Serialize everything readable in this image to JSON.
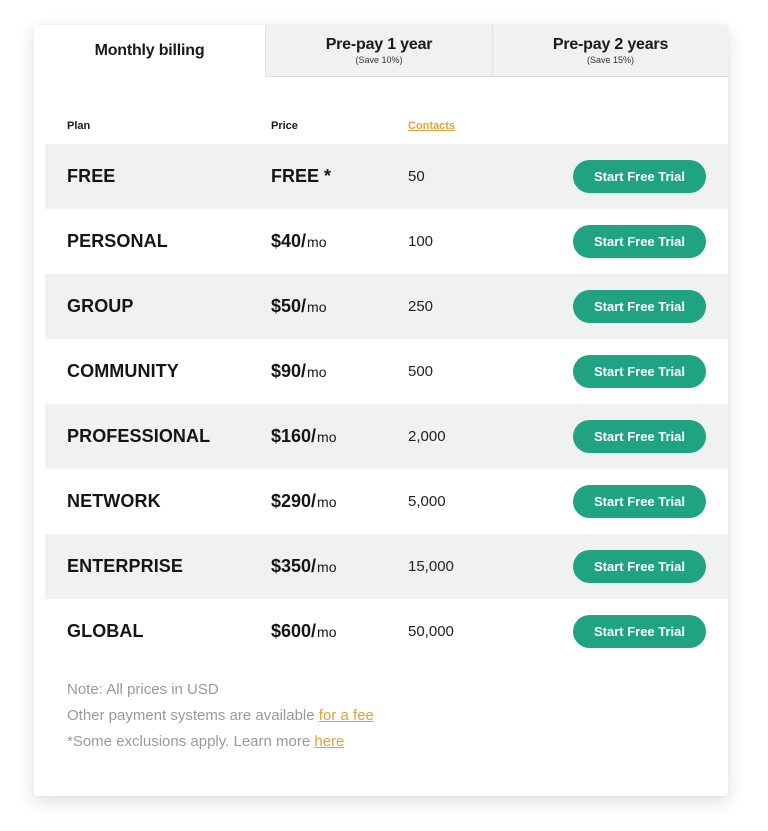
{
  "tabs": [
    {
      "title": "Monthly billing",
      "subtitle": "",
      "active": true
    },
    {
      "title": "Pre-pay 1 year",
      "subtitle": "(Save 10%)",
      "active": false
    },
    {
      "title": "Pre-pay 2 years",
      "subtitle": "(Save 15%)",
      "active": false
    }
  ],
  "table": {
    "headers": {
      "plan": "Plan",
      "price": "Price",
      "contacts": "Contacts"
    },
    "rows": [
      {
        "plan": "FREE",
        "price": "FREE *",
        "per": "",
        "contacts": "50",
        "button": "Start Free Trial"
      },
      {
        "plan": "PERSONAL",
        "price": "$40/",
        "per": "mo",
        "contacts": "100",
        "button": "Start Free Trial"
      },
      {
        "plan": "GROUP",
        "price": "$50/",
        "per": "mo",
        "contacts": "250",
        "button": "Start Free Trial"
      },
      {
        "plan": "COMMUNITY",
        "price": "$90/",
        "per": "mo",
        "contacts": "500",
        "button": "Start Free Trial"
      },
      {
        "plan": "PROFESSIONAL",
        "price": "$160/",
        "per": "mo",
        "contacts": "2,000",
        "button": "Start Free Trial"
      },
      {
        "plan": "NETWORK",
        "price": "$290/",
        "per": "mo",
        "contacts": "5,000",
        "button": "Start Free Trial"
      },
      {
        "plan": "ENTERPRISE",
        "price": "$350/",
        "per": "mo",
        "contacts": "15,000",
        "button": "Start Free Trial"
      },
      {
        "plan": "GLOBAL",
        "price": "$600/",
        "per": "mo",
        "contacts": "50,000",
        "button": "Start Free Trial"
      }
    ]
  },
  "notes": {
    "line1": "Note: All prices in USD",
    "line2_text": "Other payment systems are available ",
    "line2_link": "for a fee",
    "line3_text": "*Some exclusions apply. Learn more ",
    "line3_link": "here"
  },
  "colors": {
    "accent_button": "#1fa383",
    "link": "#d9a53a",
    "row_shade": "#f0f1f1"
  }
}
